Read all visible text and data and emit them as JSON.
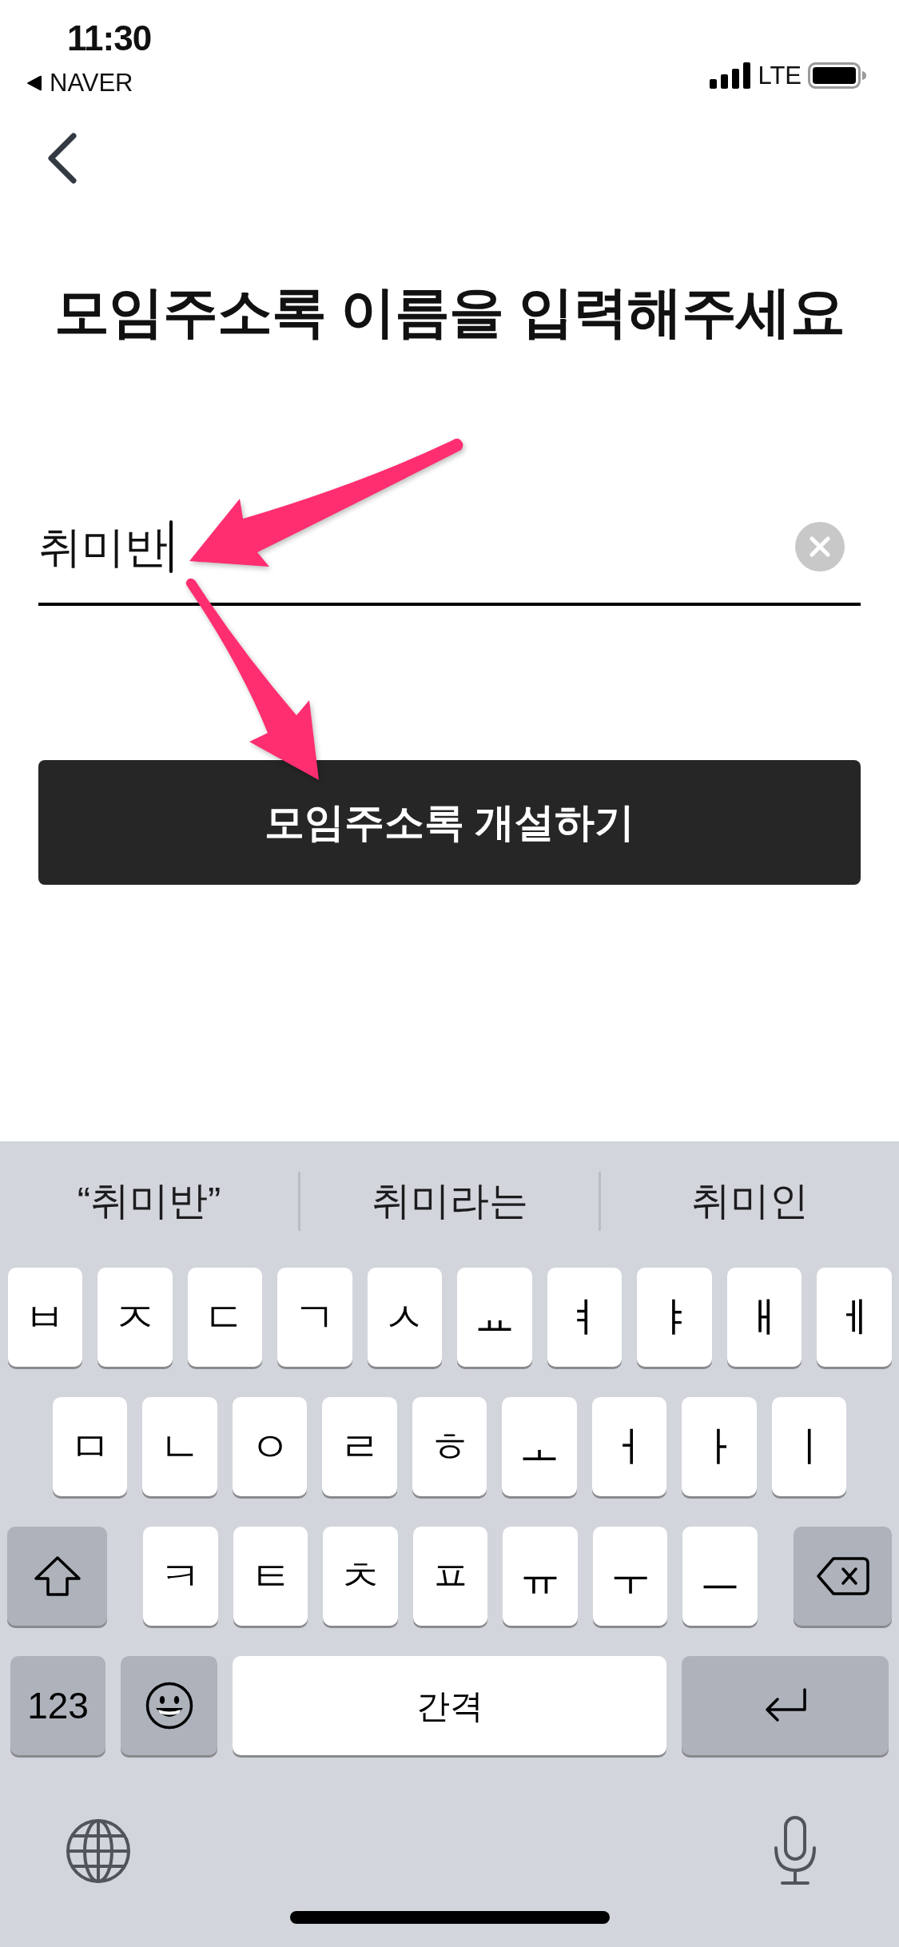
{
  "status_bar": {
    "time": "11:30",
    "back_app": "NAVER",
    "network": "LTE"
  },
  "title": "모임주소록 이름을 입력해주세요",
  "name_field": {
    "value": "취미반",
    "focused": true
  },
  "create_button": {
    "label": "모임주소록 개설하기"
  },
  "keyboard": {
    "suggestions": [
      "“취미반”",
      "취미라는",
      "취미인"
    ],
    "rows": [
      {
        "keys": [
          {
            "kind": "letter",
            "label": "ㅂ"
          },
          {
            "kind": "letter",
            "label": "ㅈ"
          },
          {
            "kind": "letter",
            "label": "ㄷ"
          },
          {
            "kind": "letter",
            "label": "ㄱ"
          },
          {
            "kind": "letter",
            "label": "ㅅ"
          },
          {
            "kind": "letter",
            "label": "ㅛ"
          },
          {
            "kind": "letter",
            "label": "ㅕ"
          },
          {
            "kind": "letter",
            "label": "ㅑ"
          },
          {
            "kind": "letter",
            "label": "ㅐ"
          },
          {
            "kind": "letter",
            "label": "ㅔ"
          }
        ]
      },
      {
        "keys": [
          {
            "kind": "letter",
            "label": "ㅁ"
          },
          {
            "kind": "letter",
            "label": "ㄴ"
          },
          {
            "kind": "letter",
            "label": "ㅇ"
          },
          {
            "kind": "letter",
            "label": "ㄹ"
          },
          {
            "kind": "letter",
            "label": "ㅎ"
          },
          {
            "kind": "letter",
            "label": "ㅗ"
          },
          {
            "kind": "letter",
            "label": "ㅓ"
          },
          {
            "kind": "letter",
            "label": "ㅏ"
          },
          {
            "kind": "letter",
            "label": "ㅣ"
          }
        ]
      },
      {
        "keys": [
          {
            "kind": "shift"
          },
          {
            "kind": "letter",
            "label": "ㅋ"
          },
          {
            "kind": "letter",
            "label": "ㅌ"
          },
          {
            "kind": "letter",
            "label": "ㅊ"
          },
          {
            "kind": "letter",
            "label": "ㅍ"
          },
          {
            "kind": "letter",
            "label": "ㅠ"
          },
          {
            "kind": "letter",
            "label": "ㅜ"
          },
          {
            "kind": "letter",
            "label": "ㅡ"
          },
          {
            "kind": "delete"
          }
        ]
      },
      {
        "keys": [
          {
            "kind": "numbers",
            "label": "123"
          },
          {
            "kind": "emoji"
          },
          {
            "kind": "space",
            "label": "간격"
          },
          {
            "kind": "return"
          }
        ]
      }
    ]
  }
}
